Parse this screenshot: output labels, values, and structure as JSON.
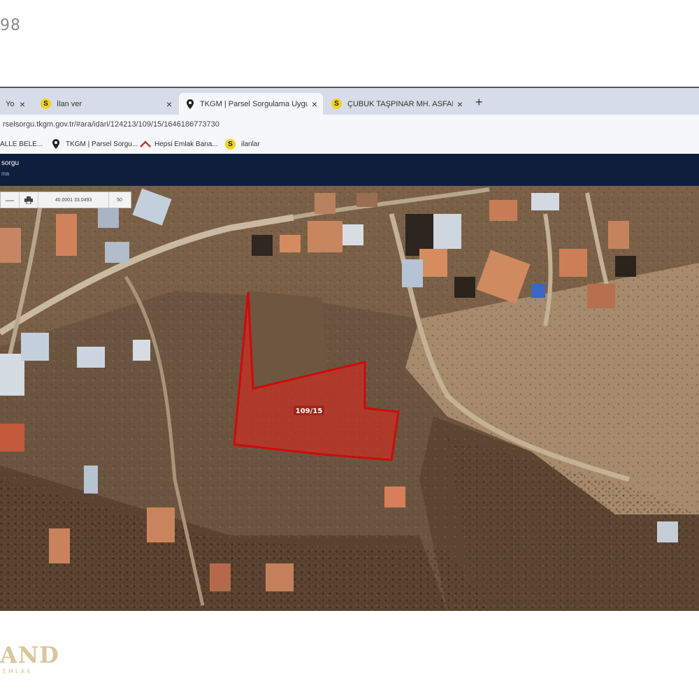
{
  "corner_number": "98",
  "browser": {
    "tabs": [
      {
        "label": "Yo",
        "favicon": "s-icon"
      },
      {
        "label": "İlan ver",
        "favicon": "s-icon"
      },
      {
        "label": "TKGM | Parsel Sorgulama Uygul",
        "favicon": "map-pin-icon"
      },
      {
        "label": "ÇUBUK TAŞPINAR MH. ASFALT",
        "favicon": "s-icon"
      }
    ],
    "new_tab": "+",
    "address": "rselsorgu.tkgm.gov.tr/#ara/idari/124213/109/15/1646186773730",
    "bookmarks": [
      {
        "label": "ALLE BELE...",
        "icon": "none"
      },
      {
        "label": "TKGM | Parsel Sorgu...",
        "icon": "map-pin-icon"
      },
      {
        "label": "Hepsi Emlak Bana...",
        "icon": "roof-icon"
      },
      {
        "label": "ilanlar",
        "icon": "s-icon"
      }
    ]
  },
  "app": {
    "title": "sorgu",
    "subtitle": "ma"
  },
  "map": {
    "toolbar": {
      "coordinates": "40.0001   33.0493",
      "scale": "50"
    },
    "parcel_label": "109/15"
  },
  "watermark": {
    "big": "AND",
    "small": "EMLAK"
  },
  "colors": {
    "tabbar": "#d6dde8",
    "header": "#0e1f3d",
    "parcel_fill": "#e0281c",
    "parcel_stroke": "#d10a0a"
  }
}
